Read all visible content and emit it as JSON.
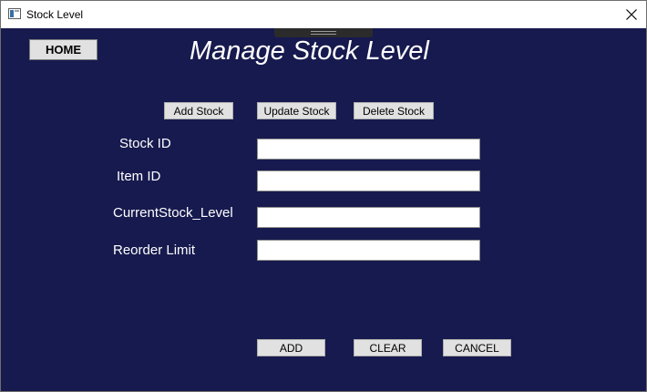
{
  "window": {
    "title": "Stock Level"
  },
  "nav": {
    "home_label": "HOME"
  },
  "heading": "Manage Stock Level",
  "tabs": {
    "add": "Add Stock",
    "update": "Update Stock",
    "delete": "Delete Stock"
  },
  "form": {
    "stock_id": {
      "label": "Stock ID",
      "value": ""
    },
    "item_id": {
      "label": "Item ID",
      "value": ""
    },
    "current_level": {
      "label": "CurrentStock_Level",
      "value": ""
    },
    "reorder_limit": {
      "label": "Reorder Limit",
      "value": ""
    }
  },
  "actions": {
    "add": "ADD",
    "clear": "CLEAR",
    "cancel": "CANCEL"
  },
  "theme": {
    "background": "#171a4e",
    "button_face": "#e1e1e1",
    "text": "#ffffff"
  }
}
